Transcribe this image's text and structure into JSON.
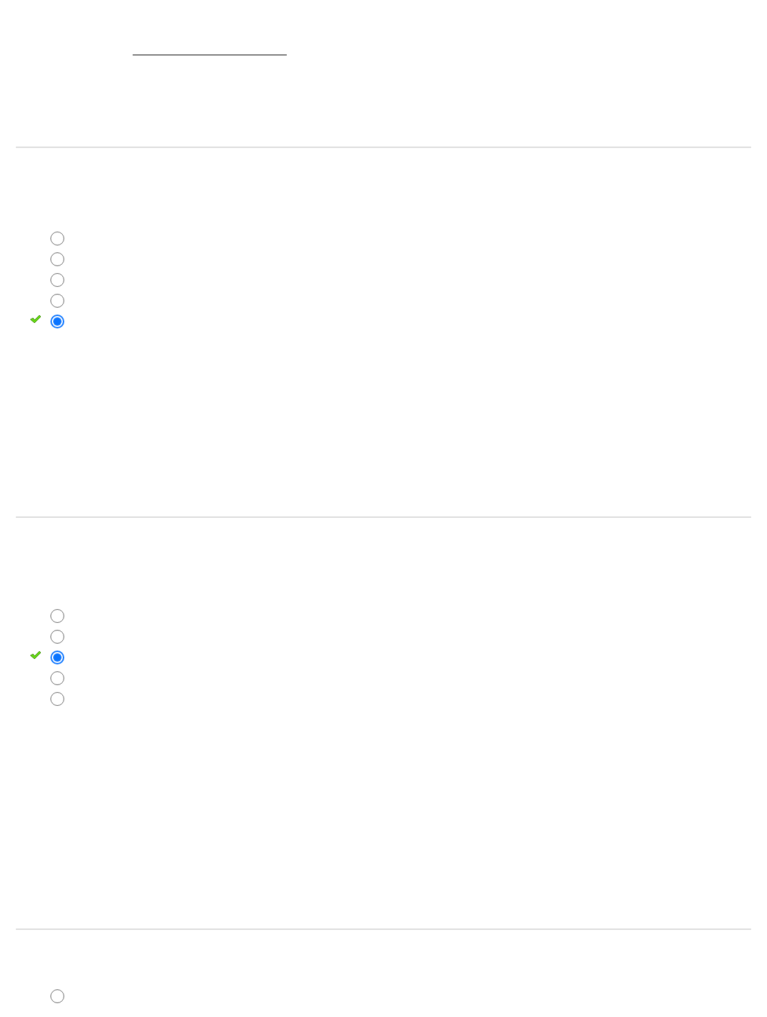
{
  "blank": {
    "kind": "fill-in-line"
  },
  "questions": [
    {
      "options": [
        {
          "selected": false,
          "correct": false
        },
        {
          "selected": false,
          "correct": false
        },
        {
          "selected": false,
          "correct": false
        },
        {
          "selected": false,
          "correct": false
        },
        {
          "selected": true,
          "correct": true
        }
      ]
    },
    {
      "options": [
        {
          "selected": false,
          "correct": false
        },
        {
          "selected": false,
          "correct": false
        },
        {
          "selected": true,
          "correct": true
        },
        {
          "selected": false,
          "correct": false
        },
        {
          "selected": false,
          "correct": false
        }
      ]
    },
    {
      "options": [
        {
          "selected": false,
          "correct": false
        }
      ]
    }
  ]
}
